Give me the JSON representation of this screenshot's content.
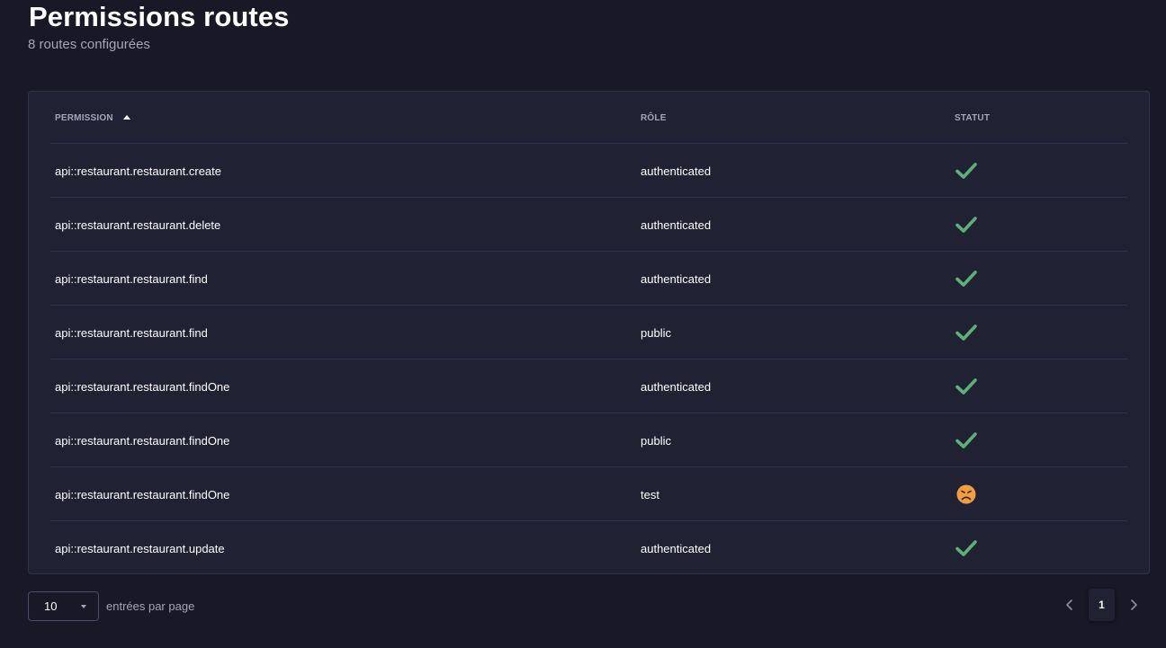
{
  "header": {
    "title": "Permissions routes",
    "subtitle": "8 routes configurées"
  },
  "table": {
    "columns": {
      "permission": "Permission",
      "role": "Rôle",
      "status": "Statut"
    },
    "sort": {
      "column": "permission",
      "direction": "ascending"
    },
    "rows": [
      {
        "permission": "api::restaurant.restaurant.create",
        "role": "authenticated",
        "status": "check-icon"
      },
      {
        "permission": "api::restaurant.restaurant.delete",
        "role": "authenticated",
        "status": "check-icon"
      },
      {
        "permission": "api::restaurant.restaurant.find",
        "role": "authenticated",
        "status": "check-icon"
      },
      {
        "permission": "api::restaurant.restaurant.find",
        "role": "public",
        "status": "check-icon"
      },
      {
        "permission": "api::restaurant.restaurant.findOne",
        "role": "authenticated",
        "status": "check-icon"
      },
      {
        "permission": "api::restaurant.restaurant.findOne",
        "role": "public",
        "status": "check-icon"
      },
      {
        "permission": "api::restaurant.restaurant.findOne",
        "role": "test",
        "status": "frown-face-icon"
      },
      {
        "permission": "api::restaurant.restaurant.update",
        "role": "authenticated",
        "status": "check-icon"
      }
    ]
  },
  "footer": {
    "page_size": "10",
    "page_size_label": "entrées par page",
    "pagination": {
      "current_page": "1",
      "prev_icon": "chevron-left-icon",
      "next_icon": "chevron-right-icon"
    }
  },
  "colors": {
    "background": "#181826",
    "card": "#212134",
    "border": "#32324d",
    "success": "#5cb176",
    "warning": "#f29d41"
  }
}
